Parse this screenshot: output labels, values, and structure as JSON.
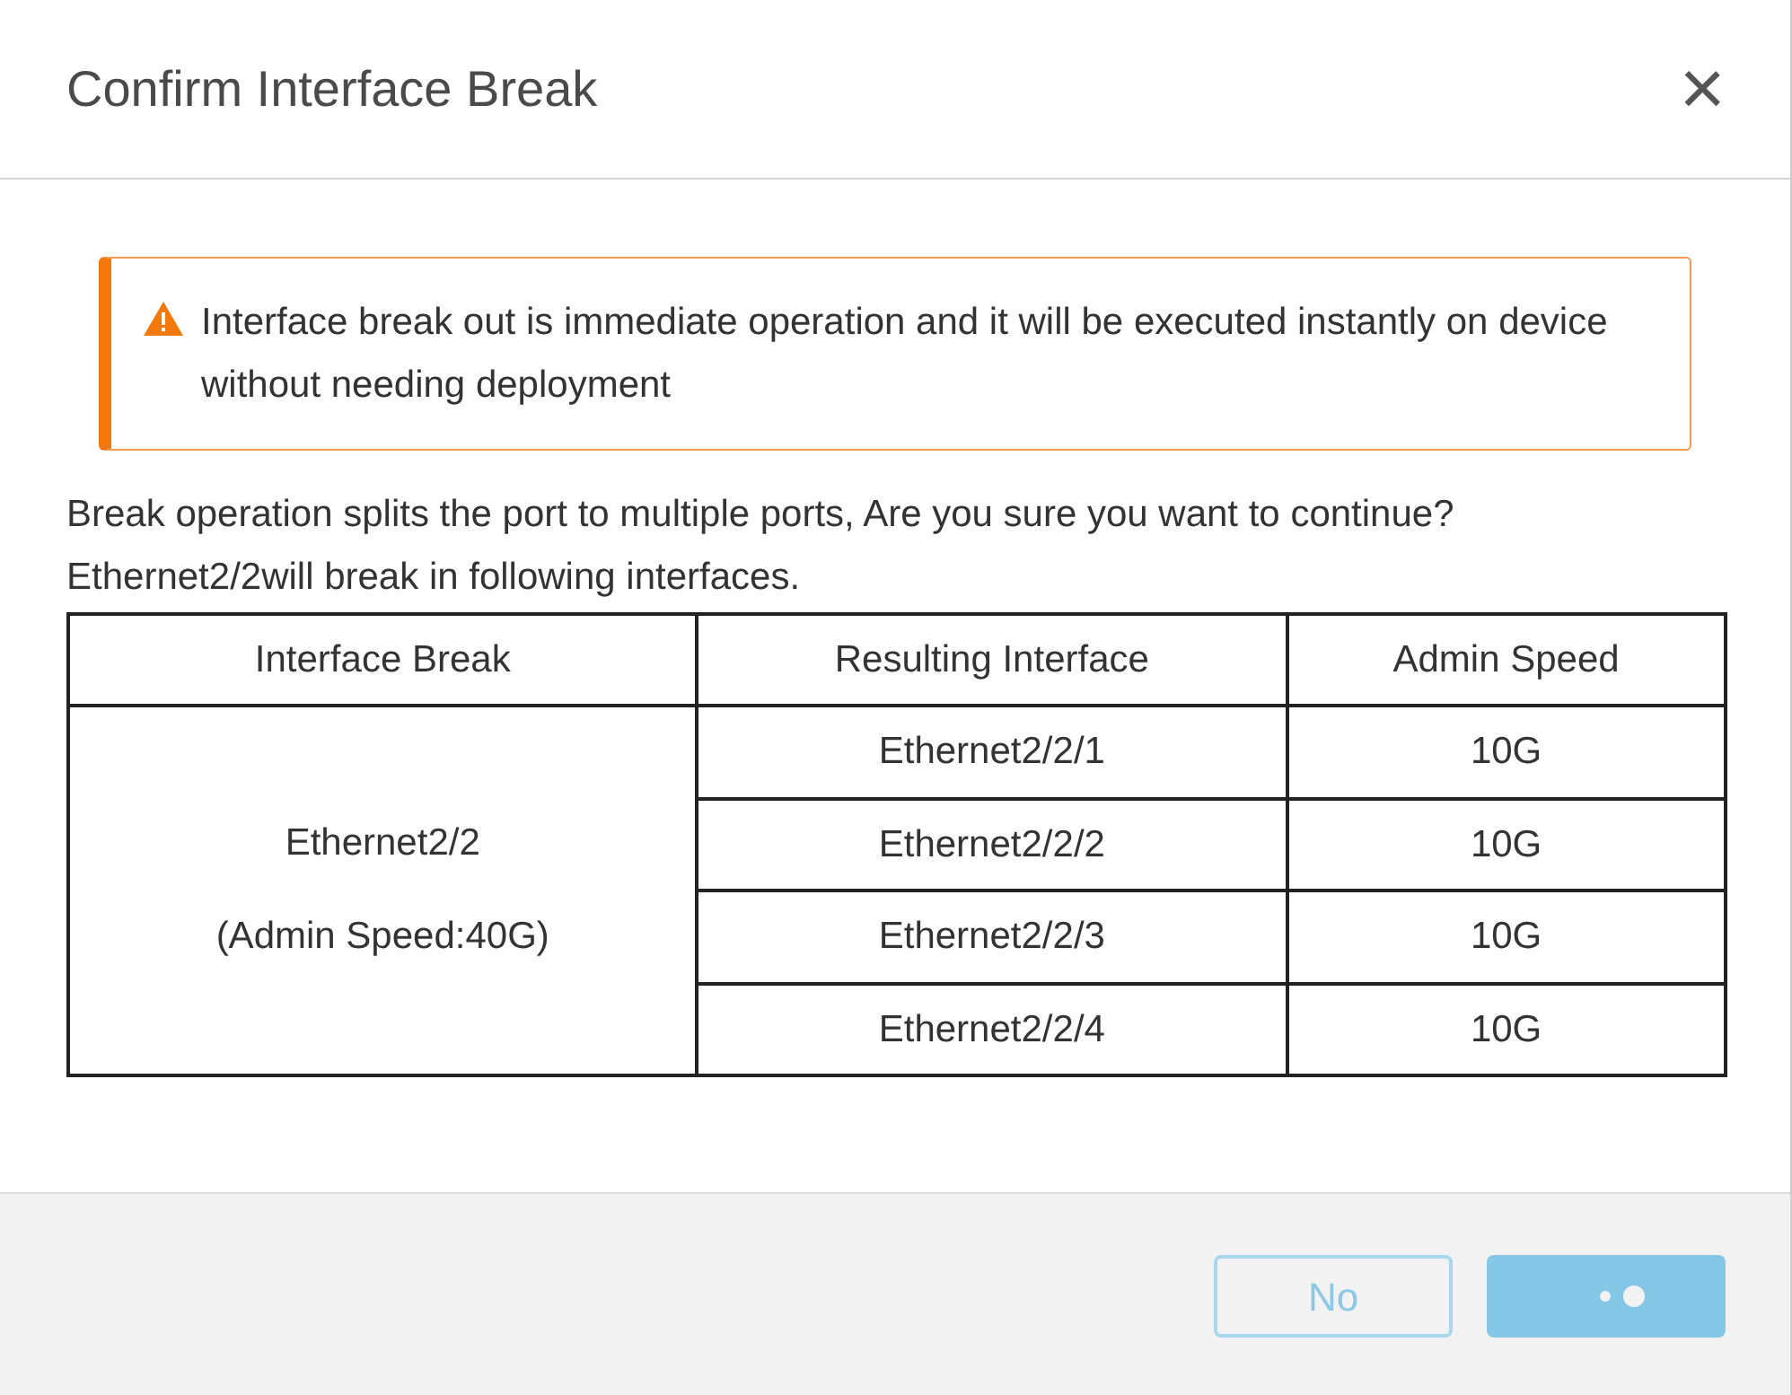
{
  "dialog": {
    "title": "Confirm Interface Break",
    "close": "×"
  },
  "warning": {
    "text": "Interface break out is immediate operation and it will be executed instantly on device without needing deployment"
  },
  "message": [
    "Break operation splits the port to multiple ports, Are you sure you want to continue?",
    "Ethernet2/2will break in following interfaces."
  ],
  "table": {
    "columns": [
      "Interface Break",
      "Resulting Interface",
      "Admin Speed"
    ],
    "source": [
      "Ethernet2/2",
      "(Admin Speed:40G)"
    ],
    "rows": [
      {
        "interface": "Ethernet2/2/1",
        "speed": "10G"
      },
      {
        "interface": "Ethernet2/2/2",
        "speed": "10G"
      },
      {
        "interface": "Ethernet2/2/3",
        "speed": "10G"
      },
      {
        "interface": "Ethernet2/2/4",
        "speed": "10G"
      }
    ]
  },
  "buttons": [
    {
      "kind": "secondary",
      "label": "No",
      "disabled": true
    },
    {
      "kind": "loading",
      "disabled": true
    }
  ]
}
